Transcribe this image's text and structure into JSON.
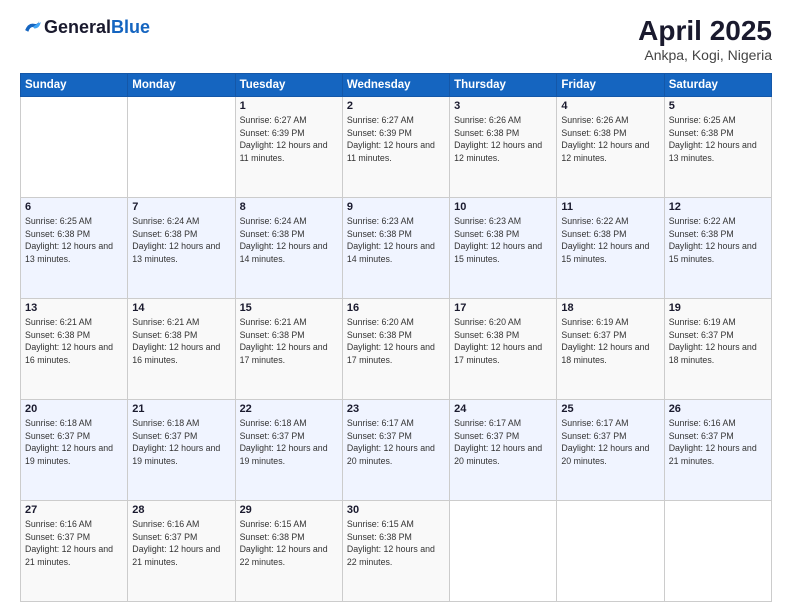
{
  "header": {
    "logo_general": "General",
    "logo_blue": "Blue",
    "title": "April 2025",
    "subtitle": "Ankpa, Kogi, Nigeria"
  },
  "calendar": {
    "days_of_week": [
      "Sunday",
      "Monday",
      "Tuesday",
      "Wednesday",
      "Thursday",
      "Friday",
      "Saturday"
    ],
    "weeks": [
      [
        {
          "day": "",
          "info": ""
        },
        {
          "day": "",
          "info": ""
        },
        {
          "day": "1",
          "info": "Sunrise: 6:27 AM\nSunset: 6:39 PM\nDaylight: 12 hours and 11 minutes."
        },
        {
          "day": "2",
          "info": "Sunrise: 6:27 AM\nSunset: 6:39 PM\nDaylight: 12 hours and 11 minutes."
        },
        {
          "day": "3",
          "info": "Sunrise: 6:26 AM\nSunset: 6:38 PM\nDaylight: 12 hours and 12 minutes."
        },
        {
          "day": "4",
          "info": "Sunrise: 6:26 AM\nSunset: 6:38 PM\nDaylight: 12 hours and 12 minutes."
        },
        {
          "day": "5",
          "info": "Sunrise: 6:25 AM\nSunset: 6:38 PM\nDaylight: 12 hours and 13 minutes."
        }
      ],
      [
        {
          "day": "6",
          "info": "Sunrise: 6:25 AM\nSunset: 6:38 PM\nDaylight: 12 hours and 13 minutes."
        },
        {
          "day": "7",
          "info": "Sunrise: 6:24 AM\nSunset: 6:38 PM\nDaylight: 12 hours and 13 minutes."
        },
        {
          "day": "8",
          "info": "Sunrise: 6:24 AM\nSunset: 6:38 PM\nDaylight: 12 hours and 14 minutes."
        },
        {
          "day": "9",
          "info": "Sunrise: 6:23 AM\nSunset: 6:38 PM\nDaylight: 12 hours and 14 minutes."
        },
        {
          "day": "10",
          "info": "Sunrise: 6:23 AM\nSunset: 6:38 PM\nDaylight: 12 hours and 15 minutes."
        },
        {
          "day": "11",
          "info": "Sunrise: 6:22 AM\nSunset: 6:38 PM\nDaylight: 12 hours and 15 minutes."
        },
        {
          "day": "12",
          "info": "Sunrise: 6:22 AM\nSunset: 6:38 PM\nDaylight: 12 hours and 15 minutes."
        }
      ],
      [
        {
          "day": "13",
          "info": "Sunrise: 6:21 AM\nSunset: 6:38 PM\nDaylight: 12 hours and 16 minutes."
        },
        {
          "day": "14",
          "info": "Sunrise: 6:21 AM\nSunset: 6:38 PM\nDaylight: 12 hours and 16 minutes."
        },
        {
          "day": "15",
          "info": "Sunrise: 6:21 AM\nSunset: 6:38 PM\nDaylight: 12 hours and 17 minutes."
        },
        {
          "day": "16",
          "info": "Sunrise: 6:20 AM\nSunset: 6:38 PM\nDaylight: 12 hours and 17 minutes."
        },
        {
          "day": "17",
          "info": "Sunrise: 6:20 AM\nSunset: 6:38 PM\nDaylight: 12 hours and 17 minutes."
        },
        {
          "day": "18",
          "info": "Sunrise: 6:19 AM\nSunset: 6:37 PM\nDaylight: 12 hours and 18 minutes."
        },
        {
          "day": "19",
          "info": "Sunrise: 6:19 AM\nSunset: 6:37 PM\nDaylight: 12 hours and 18 minutes."
        }
      ],
      [
        {
          "day": "20",
          "info": "Sunrise: 6:18 AM\nSunset: 6:37 PM\nDaylight: 12 hours and 19 minutes."
        },
        {
          "day": "21",
          "info": "Sunrise: 6:18 AM\nSunset: 6:37 PM\nDaylight: 12 hours and 19 minutes."
        },
        {
          "day": "22",
          "info": "Sunrise: 6:18 AM\nSunset: 6:37 PM\nDaylight: 12 hours and 19 minutes."
        },
        {
          "day": "23",
          "info": "Sunrise: 6:17 AM\nSunset: 6:37 PM\nDaylight: 12 hours and 20 minutes."
        },
        {
          "day": "24",
          "info": "Sunrise: 6:17 AM\nSunset: 6:37 PM\nDaylight: 12 hours and 20 minutes."
        },
        {
          "day": "25",
          "info": "Sunrise: 6:17 AM\nSunset: 6:37 PM\nDaylight: 12 hours and 20 minutes."
        },
        {
          "day": "26",
          "info": "Sunrise: 6:16 AM\nSunset: 6:37 PM\nDaylight: 12 hours and 21 minutes."
        }
      ],
      [
        {
          "day": "27",
          "info": "Sunrise: 6:16 AM\nSunset: 6:37 PM\nDaylight: 12 hours and 21 minutes."
        },
        {
          "day": "28",
          "info": "Sunrise: 6:16 AM\nSunset: 6:37 PM\nDaylight: 12 hours and 21 minutes."
        },
        {
          "day": "29",
          "info": "Sunrise: 6:15 AM\nSunset: 6:38 PM\nDaylight: 12 hours and 22 minutes."
        },
        {
          "day": "30",
          "info": "Sunrise: 6:15 AM\nSunset: 6:38 PM\nDaylight: 12 hours and 22 minutes."
        },
        {
          "day": "",
          "info": ""
        },
        {
          "day": "",
          "info": ""
        },
        {
          "day": "",
          "info": ""
        }
      ]
    ]
  }
}
